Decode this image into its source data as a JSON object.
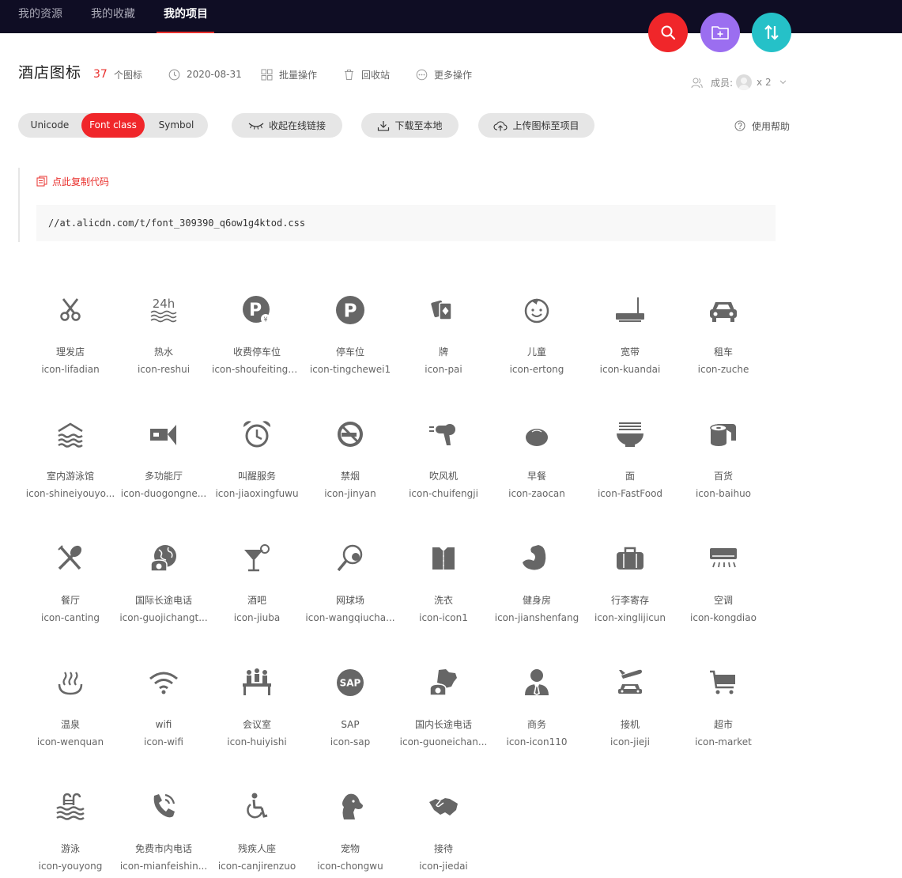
{
  "nav": {
    "tabs": [
      {
        "label": "我的资源"
      },
      {
        "label": "我的收藏"
      },
      {
        "label": "我的项目"
      }
    ],
    "active_tab": "我的项目"
  },
  "fabs": {
    "search_icon": "search-icon",
    "folder_icon": "folder-add-icon",
    "sort_icon": "sort-icon",
    "colors": {
      "search": "#f0262a",
      "folder": "#9b6ef0",
      "sort": "#25c1c8"
    }
  },
  "project": {
    "title": "酒店图标",
    "icon_count": "37",
    "icon_count_unit": "个图标",
    "date": "2020-08-31",
    "batch_label": "批量操作",
    "recycle_label": "回收站",
    "more_label": "更多操作",
    "members_label": "成员:",
    "members_count": "x 2"
  },
  "toolbar": {
    "formats": [
      "Unicode",
      "Font class",
      "Symbol"
    ],
    "active_format": "Font class",
    "collapse_label": "收起在线链接",
    "download_label": "下载至本地",
    "upload_label": "上传图标至项目",
    "help_label": "使用帮助"
  },
  "code": {
    "copy_label": "点此复制代码",
    "url": "//at.alicdn.com/t/font_309390_q6ow1g4ktod.css"
  },
  "icons": [
    {
      "name": "理发店",
      "cls": "icon-lifadian",
      "icon": "scissors-icon"
    },
    {
      "name": "热水",
      "cls": "icon-reshui",
      "icon": "hot-water-icon"
    },
    {
      "name": "收费停车位",
      "cls": "icon-shoufeitingc...",
      "icon": "paid-parking-icon"
    },
    {
      "name": "停车位",
      "cls": "icon-tingchewei1",
      "icon": "parking-icon"
    },
    {
      "name": "牌",
      "cls": "icon-pai",
      "icon": "cards-icon"
    },
    {
      "name": "儿童",
      "cls": "icon-ertong",
      "icon": "child-icon"
    },
    {
      "name": "宽带",
      "cls": "icon-kuandai",
      "icon": "router-icon"
    },
    {
      "name": "租车",
      "cls": "icon-zuche",
      "icon": "car-icon"
    },
    {
      "name": "室内游泳馆",
      "cls": "icon-shineiyouyo...",
      "icon": "indoor-pool-icon"
    },
    {
      "name": "多功能厅",
      "cls": "icon-duogongne...",
      "icon": "projector-icon"
    },
    {
      "name": "叫醒服务",
      "cls": "icon-jiaoxingfuwu",
      "icon": "alarm-clock-icon"
    },
    {
      "name": "禁烟",
      "cls": "icon-jinyan",
      "icon": "no-smoking-icon"
    },
    {
      "name": "吹风机",
      "cls": "icon-chuifengji",
      "icon": "hair-dryer-icon"
    },
    {
      "name": "早餐",
      "cls": "icon-zaocan",
      "icon": "bun-icon"
    },
    {
      "name": "面",
      "cls": "icon-FastFood",
      "icon": "noodle-bowl-icon"
    },
    {
      "name": "百货",
      "cls": "icon-baihuo",
      "icon": "paper-roll-icon"
    },
    {
      "name": "餐厅",
      "cls": "icon-canting",
      "icon": "restaurant-icon"
    },
    {
      "name": "国际长途电话",
      "cls": "icon-guojichangt...",
      "icon": "international-phone-icon"
    },
    {
      "name": "酒吧",
      "cls": "icon-jiuba",
      "icon": "cocktail-icon"
    },
    {
      "name": "网球场",
      "cls": "icon-wangqiucha...",
      "icon": "tennis-icon"
    },
    {
      "name": "洗衣",
      "cls": "icon-icon1",
      "icon": "laundry-shirt-icon"
    },
    {
      "name": "健身房",
      "cls": "icon-jianshenfang",
      "icon": "muscle-arm-icon"
    },
    {
      "name": "行李寄存",
      "cls": "icon-xinglijicun",
      "icon": "luggage-icon"
    },
    {
      "name": "空调",
      "cls": "icon-kongdiao",
      "icon": "air-conditioner-icon"
    },
    {
      "name": "温泉",
      "cls": "icon-wenquan",
      "icon": "hot-spring-icon"
    },
    {
      "name": "wifi",
      "cls": "icon-wifi",
      "icon": "wifi-icon"
    },
    {
      "name": "会议室",
      "cls": "icon-huiyishi",
      "icon": "meeting-room-icon"
    },
    {
      "name": "SAP",
      "cls": "icon-sap",
      "icon": "sap-icon"
    },
    {
      "name": "国内长途电话",
      "cls": "icon-guoneichan...",
      "icon": "domestic-phone-icon"
    },
    {
      "name": "商务",
      "cls": "icon-icon110",
      "icon": "business-person-icon"
    },
    {
      "name": "接机",
      "cls": "icon-jieji",
      "icon": "airport-pickup-icon"
    },
    {
      "name": "超市",
      "cls": "icon-market",
      "icon": "shopping-cart-icon"
    },
    {
      "name": "游泳",
      "cls": "icon-youyong",
      "icon": "swimming-icon"
    },
    {
      "name": "免费市内电话",
      "cls": "icon-mianfeishin...",
      "icon": "free-call-icon"
    },
    {
      "name": "残疾人座",
      "cls": "icon-canjirenzuo",
      "icon": "wheelchair-icon"
    },
    {
      "name": "宠物",
      "cls": "icon-chongwu",
      "icon": "pet-dog-icon"
    },
    {
      "name": "接待",
      "cls": "icon-jiedai",
      "icon": "handshake-icon"
    }
  ]
}
